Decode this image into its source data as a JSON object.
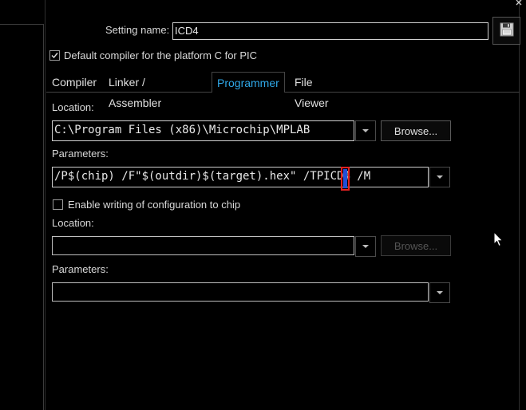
{
  "header": {
    "setting_name_label": "Setting name:",
    "setting_name_value": "ICD4",
    "save_icon": "floppy-disk-icon",
    "close_icon": "close-icon"
  },
  "default_compiler": {
    "checked": true,
    "label": "Default compiler for the platform C for PIC"
  },
  "tabs": [
    {
      "label": "Compiler",
      "active": false
    },
    {
      "label": "Linker / Assembler",
      "active": false
    },
    {
      "label": "Programmer",
      "active": true
    },
    {
      "label": "File Viewer",
      "active": false
    }
  ],
  "programmer": {
    "location_label": "Location:",
    "location_value": "C:\\Program Files (x86)\\Microchip\\MPLAB",
    "browse_label": "Browse...",
    "parameters_label": "Parameters:",
    "parameters_value_before": "/P$(chip) /F\"$(outdir)$(target).hex\" ",
    "parameters_value_after": "/TPICD4 /M"
  },
  "config": {
    "checked": false,
    "label": "Enable writing of configuration to chip",
    "location_label": "Location:",
    "location_value": "",
    "browse_label": "Browse...",
    "parameters_label": "Parameters:",
    "parameters_value": ""
  },
  "colors": {
    "background": "#000000",
    "active_tab": "#2fa8e8",
    "caret_highlight": "#e02020",
    "selection": "#1f4fd8"
  }
}
